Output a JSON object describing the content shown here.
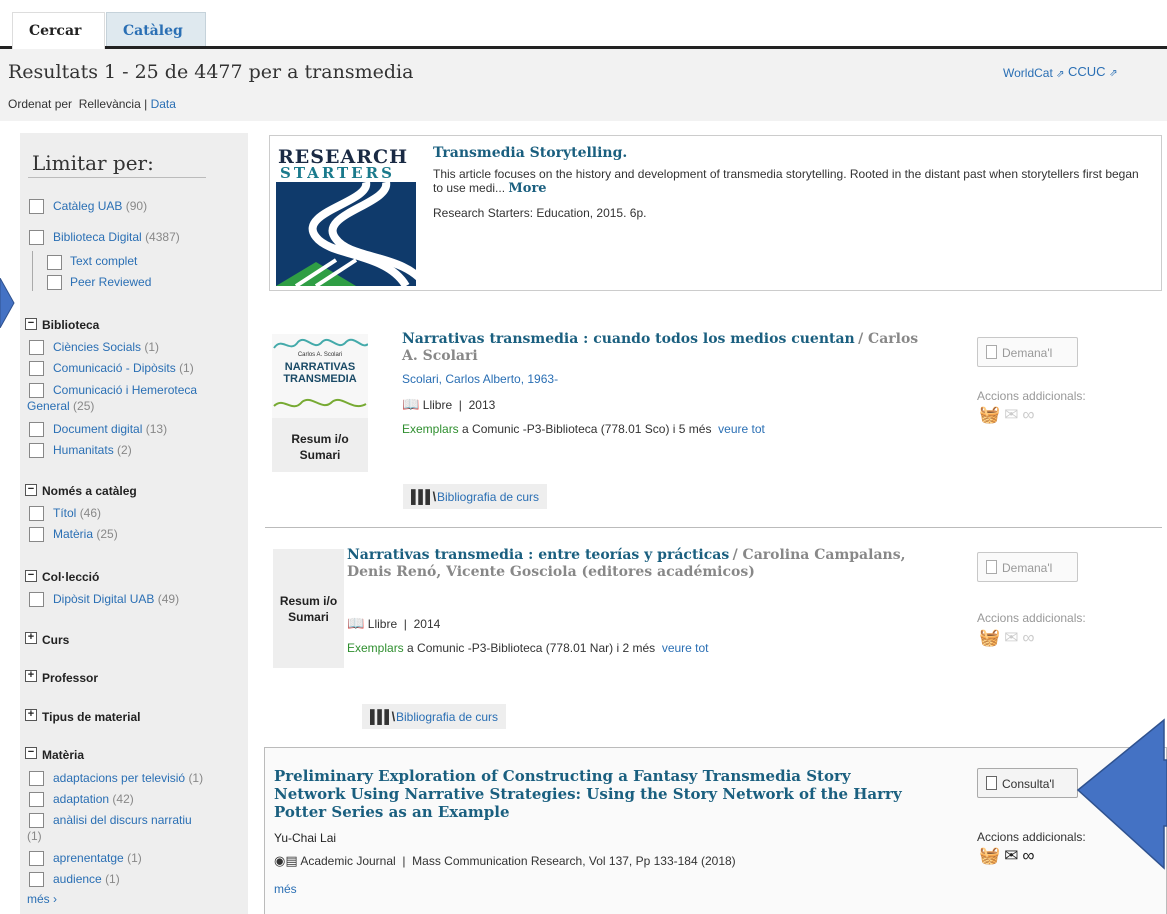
{
  "tabs": {
    "search": "Cercar",
    "catalog": "Catàleg"
  },
  "header": {
    "results_text": "Resultats 1 - 25 de 4477 per a transmedia",
    "sort_label": "Ordenat per",
    "sort_relevance": "Rellevància",
    "sort_sep": "|",
    "sort_date": "Data",
    "worldcat": "WorldCat",
    "ccuc": "CCUC"
  },
  "sidebar": {
    "title": "Limitar per:",
    "top_facets": [
      {
        "label": "Catàleg UAB",
        "count": "(90)"
      },
      {
        "label": "Biblioteca Digital",
        "count": "(4387)"
      }
    ],
    "sub_facets": [
      {
        "label": "Text complet"
      },
      {
        "label": "Peer Reviewed"
      }
    ],
    "biblioteca": {
      "title": "Biblioteca",
      "items": [
        {
          "label": "Ciències Socials",
          "count": "(1)"
        },
        {
          "label": "Comunicació - Dipòsits",
          "count": "(1)"
        },
        {
          "label": "Comunicació i Hemeroteca",
          "label2": "General",
          "count": "(25)"
        },
        {
          "label": "Document digital",
          "count": "(13)"
        },
        {
          "label": "Humanitats",
          "count": "(2)"
        }
      ]
    },
    "nomes": {
      "title": "Només a catàleg",
      "items": [
        {
          "label": "Títol",
          "count": "(46)"
        },
        {
          "label": "Matèria",
          "count": "(25)"
        }
      ]
    },
    "colleccio": {
      "title": "Col·lecció",
      "items": [
        {
          "label": "Dipòsit Digital UAB",
          "count": "(49)"
        }
      ]
    },
    "collapsed": [
      "Curs",
      "Professor",
      "Tipus de material"
    ],
    "materia": {
      "title": "Matèria",
      "items": [
        {
          "label": "adaptacions per televisió",
          "count": "(1)"
        },
        {
          "label": "adaptation",
          "count": "(42)"
        },
        {
          "label": "anàlisi del discurs narratiu",
          "label2": "",
          "count": "(1)"
        },
        {
          "label": "aprenentatge",
          "count": "(1)"
        },
        {
          "label": "audience",
          "count": "(1)"
        }
      ],
      "more": "més"
    },
    "plus": "+",
    "minus": "−"
  },
  "research_starter": {
    "logo_line1": "RESEARCH",
    "logo_line2": "STARTERS",
    "title": "Transmedia Storytelling.",
    "abstract": "This article focuses on the history and development of transmedia storytelling. Rooted in the distant past when storytellers first began to use medi...",
    "more": "More",
    "source": "Research Starters: Education, 2015. 6p."
  },
  "results": [
    {
      "title": "Narrativas transmedia : cuando todos los medios cuentan",
      "author": "/ Carlos A. Scolari",
      "creator": "Scolari, Carlos Alberto, 1963-",
      "format": "Llibre",
      "year": "2013",
      "copies_link": "Exemplars",
      "copies_text": "a Comunic -P3-Biblioteca (778.01 Sco) i 5 més",
      "see_all": "veure tot",
      "cover_line1": "Carlos A. Scolari",
      "cover_line2": "NARRATIVAS",
      "cover_line3": "TRANSMEDIA",
      "summary": "Resum i/o Sumari",
      "bib": "Bibliografia de curs",
      "request": "Demana'l",
      "more_actions": "Accions addicionals:"
    },
    {
      "title": "Narrativas transmedia : entre teorías y prácticas",
      "author": "/ Carolina Campalans, Denis Renó, Vicente Gosciola (editores académicos)",
      "format": "Llibre",
      "year": "2014",
      "copies_link": "Exemplars",
      "copies_text": "a Comunic -P3-Biblioteca (778.01 Nar) i 2 més",
      "see_all": "veure tot",
      "summary": "Resum i/o Sumari",
      "bib": "Bibliografia de curs",
      "request": "Demana'l",
      "more_actions": "Accions addicionals:"
    },
    {
      "title": "Preliminary Exploration of Constructing a Fantasy Transmedia Story Network Using Narrative Strategies: Using the Story Network of the Harry Potter Series as an Example",
      "creator": "Yu-Chai Lai",
      "format": "Academic Journal",
      "source": "Mass Communication Research, Vol 137, Pp 133-184 (2018)",
      "more": "més",
      "consult": "Consulta'l",
      "more_actions": "Accions addicionals:"
    }
  ],
  "colors": {
    "arrow": "#4472c4",
    "link": "#2a6fb4",
    "title": "#1a5f7f"
  }
}
